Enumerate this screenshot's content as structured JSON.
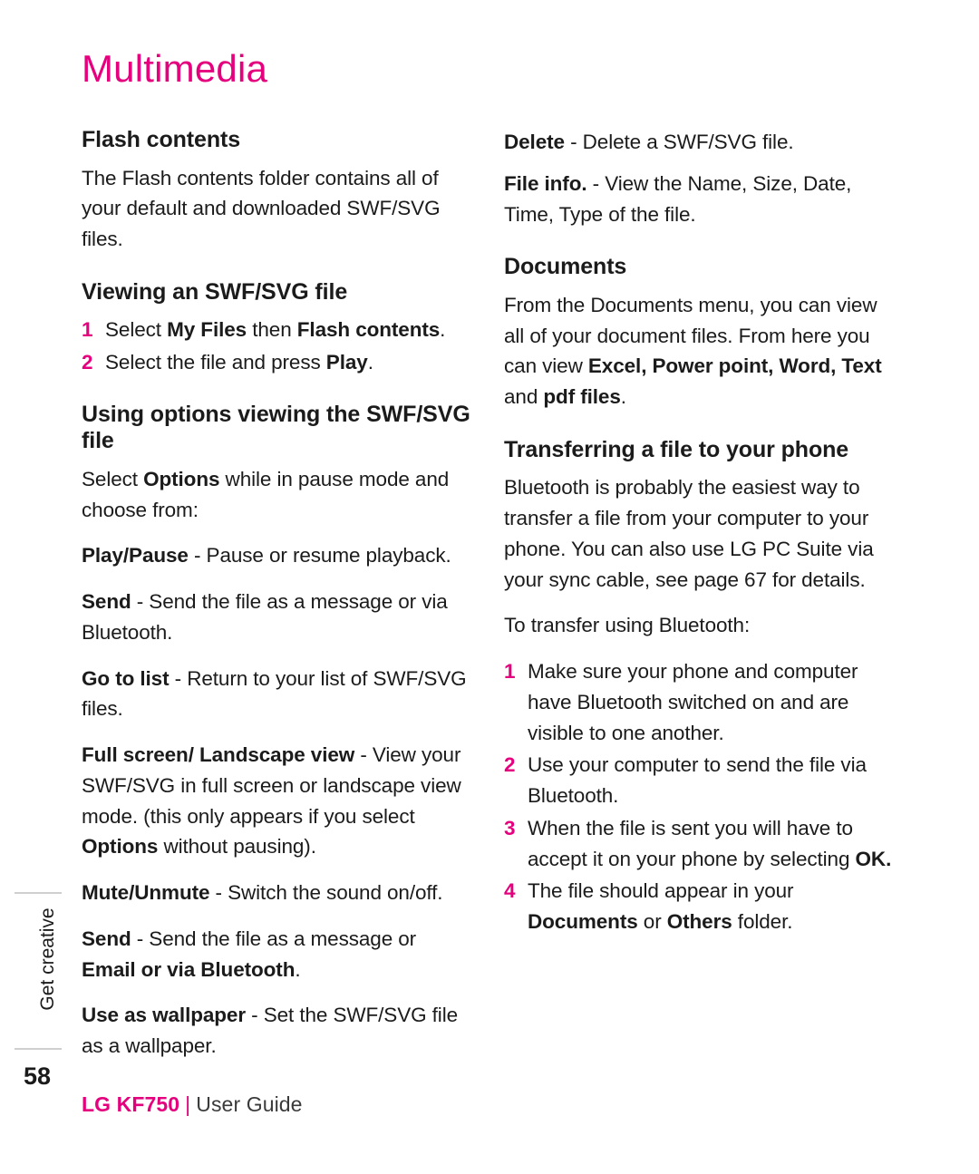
{
  "document": {
    "title": "Multimedia",
    "side_tab": "Get creative",
    "page_number": "58",
    "footer": {
      "model": "LG KF750",
      "separator": "|",
      "guide": "User Guide"
    }
  },
  "left_column": {
    "flash_contents": {
      "heading": "Flash contents",
      "paragraph": "The Flash contents folder contains all of your default and downloaded SWF/SVG files."
    },
    "viewing": {
      "heading": "Viewing an SWF/SVG file",
      "steps": [
        {
          "num": "1",
          "pre": "Select ",
          "bold1": "My Files",
          "mid": " then ",
          "bold2": "Flash contents",
          "post": "."
        },
        {
          "num": "2",
          "pre": "Select the file and press ",
          "bold1": "Play",
          "mid": "",
          "bold2": "",
          "post": "."
        }
      ]
    },
    "using_options": {
      "heading": "Using options viewing the SWF/SVG file",
      "intro_pre": "Select ",
      "intro_bold": "Options",
      "intro_post": " while in pause mode and choose from:",
      "items": [
        {
          "term": "Play/Pause",
          "desc": " - Pause or resume playback."
        },
        {
          "term": "Send",
          "desc": " - Send the file as a message or via Bluetooth."
        },
        {
          "term": "Go to list",
          "desc": " - Return to your list of SWF/SVG files."
        },
        {
          "term": "Full screen/ Landscape view",
          "desc": " - View your SWF/SVG in full screen or landscape view mode. (this only appears if you select ",
          "term2": "Options",
          "desc2": " without pausing)."
        },
        {
          "term": "Mute/Unmute",
          "desc": " - Switch the sound on/off."
        },
        {
          "term": "Send",
          "desc": " - Send the file as a message or ",
          "term2": "Email or via Bluetooth",
          "desc2": "."
        },
        {
          "term": "Use as wallpaper",
          "desc": " - Set the SWF/SVG file as a wallpaper."
        }
      ]
    }
  },
  "right_column": {
    "top_items": [
      {
        "term": "Delete",
        "desc": " - Delete a SWF/SVG file."
      },
      {
        "term": "File info.",
        "desc": " - View the Name, Size, Date, Time, Type of the file."
      }
    ],
    "documents": {
      "heading": "Documents",
      "para_pre": "From the Documents menu, you can view all of your document files. From here you can view ",
      "bold_list": "Excel, Power point, Word, Text",
      "para_mid": " and ",
      "bold_end": "pdf files",
      "para_post": "."
    },
    "transferring": {
      "heading": "Transferring a file to your phone",
      "paragraph": "Bluetooth is probably the easiest way to transfer a file from your computer to your phone. You can also use LG PC Suite via your sync cable, see page 67 for details.",
      "subparagraph": "To transfer using Bluetooth:",
      "steps": [
        {
          "num": "1",
          "text": "Make sure your phone and computer have Bluetooth switched on and are visible to one another.",
          "bold_tail": ""
        },
        {
          "num": "2",
          "text": "Use your computer to send the file via Bluetooth.",
          "bold_tail": ""
        },
        {
          "num": "3",
          "text": "When the file is sent you will have to accept it on your phone by selecting ",
          "bold_tail": "OK."
        },
        {
          "num": "4",
          "text": "The file should appear in your ",
          "bold_tail": "Documents",
          "mid": " or ",
          "bold_tail2": "Others",
          "tail_post": " folder."
        }
      ]
    }
  }
}
